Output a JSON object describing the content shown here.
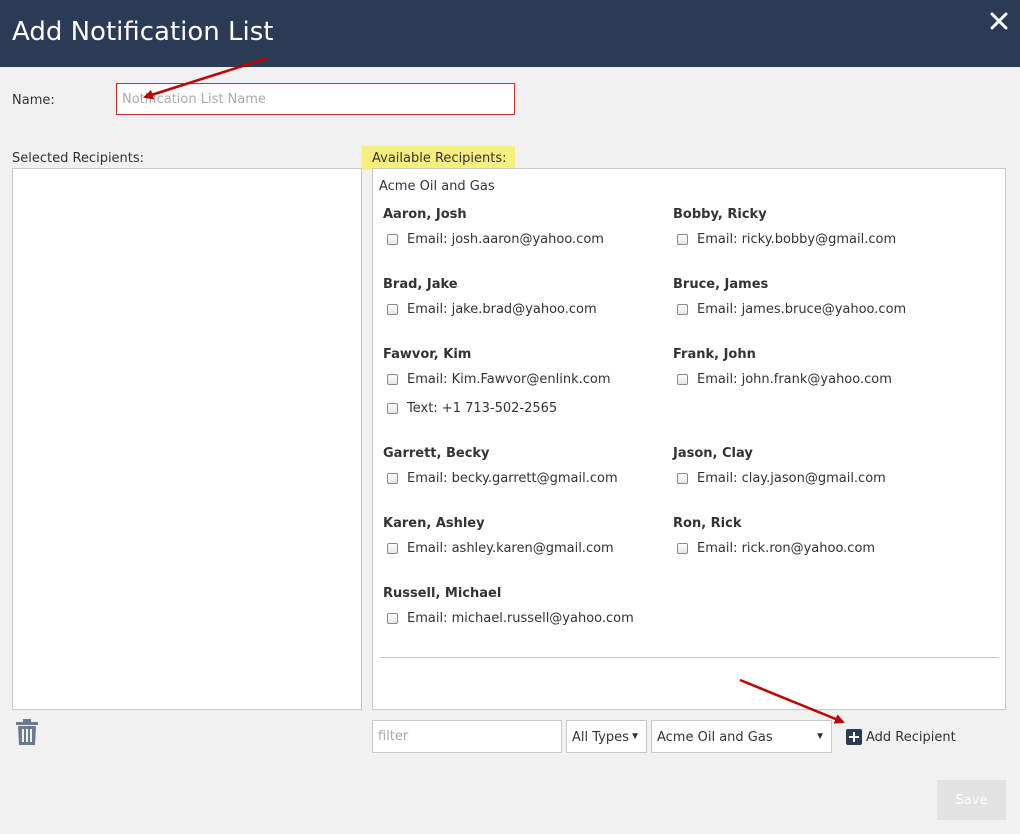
{
  "dialog": {
    "title": "Add Notification List"
  },
  "name_field": {
    "label": "Name:",
    "placeholder": "Notification List Name",
    "value": ""
  },
  "selected_recipients": {
    "label": "Selected Recipients:"
  },
  "available_recipients": {
    "label": "Available Recipients:",
    "highlight_color": "#f6f07a",
    "company": "Acme Oil and Gas",
    "contacts": [
      {
        "name": "Aaron, Josh",
        "methods": [
          "Email: josh.aaron@yahoo.com"
        ]
      },
      {
        "name": "Bobby, Ricky",
        "methods": [
          "Email: ricky.bobby@gmail.com"
        ]
      },
      {
        "name": "Brad, Jake",
        "methods": [
          "Email: jake.brad@yahoo.com"
        ]
      },
      {
        "name": "Bruce, James",
        "methods": [
          "Email: james.bruce@yahoo.com"
        ]
      },
      {
        "name": "Fawvor, Kim",
        "methods": [
          "Email: Kim.Fawvor@enlink.com",
          "Text: +1 713-502-2565"
        ]
      },
      {
        "name": "Frank, John",
        "methods": [
          "Email: john.frank@yahoo.com"
        ]
      },
      {
        "name": "Garrett, Becky",
        "methods": [
          "Email: becky.garrett@gmail.com"
        ]
      },
      {
        "name": "Jason, Clay",
        "methods": [
          "Email: clay.jason@gmail.com"
        ]
      },
      {
        "name": "Karen, Ashley",
        "methods": [
          "Email: ashley.karen@gmail.com"
        ]
      },
      {
        "name": "Ron, Rick",
        "methods": [
          "Email: rick.ron@yahoo.com"
        ]
      },
      {
        "name": "Russell, Michael",
        "methods": [
          "Email: michael.russell@yahoo.com"
        ]
      }
    ]
  },
  "toolbar": {
    "filter_placeholder": "filter",
    "type_select": "All Types",
    "company_select": "Acme Oil and Gas",
    "add_recipient_label": "Add Recipient"
  },
  "footer": {
    "save_label": "Save"
  },
  "colors": {
    "header_bg": "#2b3a55",
    "annotation_arrow": "#c00000",
    "name_border": "#c9302c"
  },
  "icons": {
    "close": "close-icon",
    "trash": "trash-icon",
    "add": "plus-square-icon"
  }
}
